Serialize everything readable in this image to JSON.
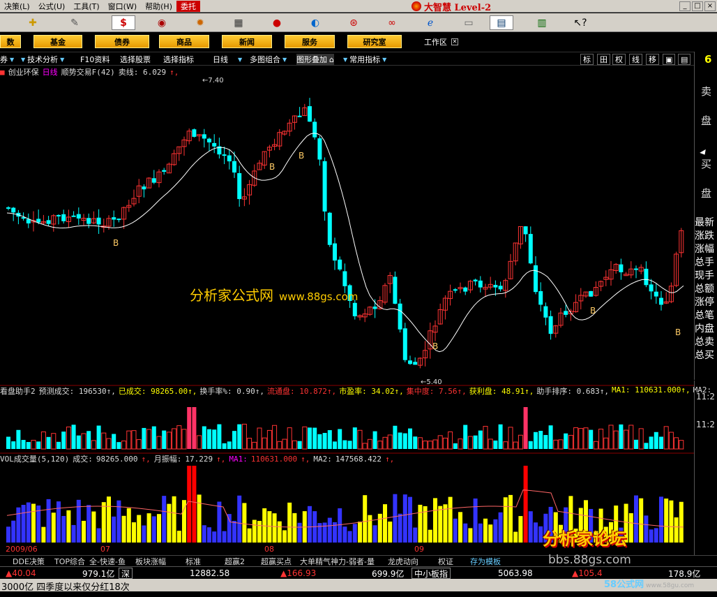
{
  "menu": {
    "items": [
      "决策(L)",
      "公式(U)",
      "工具(T)",
      "窗口(W)",
      "帮助(H)",
      "委托"
    ],
    "brand": "大智慧 Level-2"
  },
  "categories": [
    "基金",
    "债券",
    "商品",
    "新闻",
    "服务",
    "研究室"
  ],
  "workspace_label": "工作区",
  "funcbar": {
    "items": [
      "技术分析",
      "F10资料",
      "选择股票",
      "选择指标",
      "日线",
      "多图组合",
      "图形叠加",
      "常用指标"
    ],
    "right_buttons": [
      "标",
      "田",
      "权",
      "线",
      "移",
      "▣",
      "▤"
    ]
  },
  "main_panel": {
    "stock_name": "创业环保",
    "period": "日线",
    "indicator": "顺势交易F(42)",
    "sell_label": "卖线: 6.029",
    "high_label": "7.40",
    "low_label": "5.40",
    "signal_label": "B"
  },
  "panel2": {
    "name": "看盘助手2",
    "items": [
      {
        "label": "预测成交:",
        "value": "196530",
        "color": "w"
      },
      {
        "label": "已成交:",
        "value": "98265.00",
        "color": "y"
      },
      {
        "label": "换手率%:",
        "value": "0.90",
        "color": "w"
      },
      {
        "label": "流通盘:",
        "value": "10.872",
        "color": "r"
      },
      {
        "label": "市盈率:",
        "value": "34.02",
        "color": "y"
      },
      {
        "label": "集中度:",
        "value": "7.56",
        "color": "r"
      },
      {
        "label": "获利盘:",
        "value": "48.91",
        "color": "y"
      },
      {
        "label": "助手排序:",
        "value": "0.683",
        "color": "w"
      },
      {
        "label": "MA1:",
        "value": "110631.000",
        "color": "y"
      },
      {
        "label": "MA2:",
        "value": "",
        "color": "w"
      }
    ]
  },
  "panel3": {
    "name": "VOL成交量(5,120)",
    "turnover_label": "成交:",
    "turnover_value": "98265.000",
    "amplitude_label": "月振幅:",
    "amplitude_value": "17.229",
    "ma1_label": "MA1:",
    "ma1_value": "110631.000",
    "ma2_label": "MA2:",
    "ma2_value": "147568.422"
  },
  "dates": [
    "2009/06",
    "07",
    "08",
    "09"
  ],
  "watermark": {
    "text": "分析家公式网",
    "url": "www.88gs.com"
  },
  "right_panel": {
    "sell": [
      "卖",
      "盘"
    ],
    "buy": [
      "买",
      "盘"
    ],
    "list": [
      "最新",
      "涨跌",
      "涨幅",
      "总手",
      "现手",
      "总额",
      "涨停",
      "总笔",
      "内盘",
      "总卖",
      "总买"
    ],
    "top_digit": "6",
    "time1": "11:2",
    "time2": "11:2"
  },
  "bottom_tabs": [
    "DDE决策",
    "TOP综合",
    "全-快速-鱼",
    "板块涨幅",
    "标准",
    "超赢2",
    "超赢买点",
    "大单精气神力-弱者-量",
    "龙虎动向",
    "权证",
    "存为模板"
  ],
  "status": {
    "idx1_change": "40.04",
    "idx1_amount": "979.1亿",
    "mkt2": "深",
    "idx2_value": "12882.58",
    "idx2_change": "166.93",
    "idx2_amount": "699.9亿",
    "board": "中小板指",
    "board_value": "5063.98",
    "board_change": "105.4",
    "extra": "178.9亿"
  },
  "ticker": "3000亿 四季度以来仅分红18次",
  "forum": {
    "title": "分析家论坛",
    "url": "bbs.88gs.com"
  },
  "site": {
    "name": "58公式网",
    "url": "www.58gu.com"
  },
  "colors": {
    "up": "#ff3333",
    "down": "#00ffff",
    "ma": "#ffffff",
    "vol_up": "#ffff00",
    "vol_down": "#3333ff",
    "accent": "#ffcc00"
  }
}
